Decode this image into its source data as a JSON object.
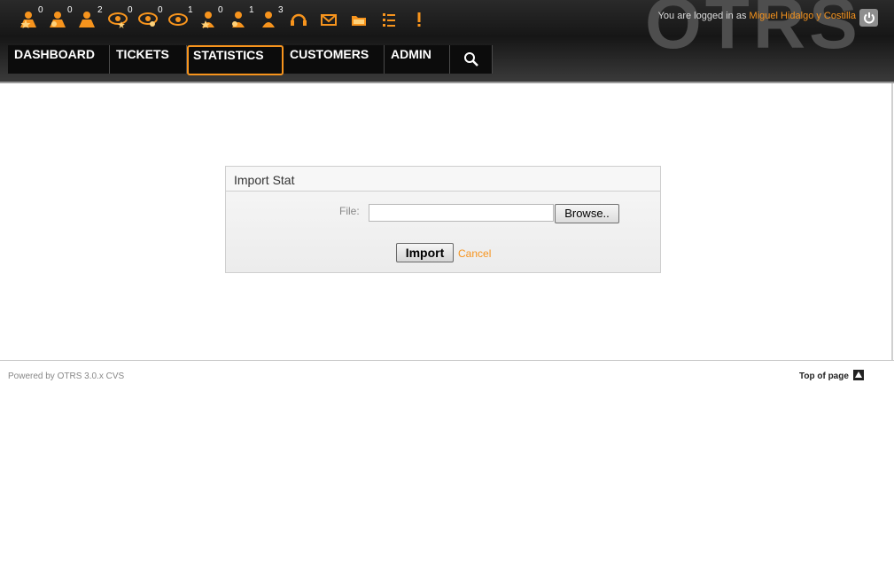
{
  "toolbar": {
    "icons": [
      {
        "name": "locked-new-tickets-icon",
        "count": "0"
      },
      {
        "name": "locked-reminder-tickets-icon",
        "count": "0"
      },
      {
        "name": "locked-tickets-icon",
        "count": "2"
      },
      {
        "name": "watched-new-tickets-icon",
        "count": "0"
      },
      {
        "name": "watched-reminder-tickets-icon",
        "count": "0"
      },
      {
        "name": "watched-tickets-icon",
        "count": "1"
      },
      {
        "name": "responsible-new-tickets-icon",
        "count": "0"
      },
      {
        "name": "responsible-reminder-tickets-icon",
        "count": "1"
      },
      {
        "name": "responsible-tickets-icon",
        "count": "3"
      },
      {
        "name": "new-phone-ticket-icon",
        "count": ""
      },
      {
        "name": "new-email-ticket-icon",
        "count": ""
      },
      {
        "name": "ticket-queue-icon",
        "count": ""
      },
      {
        "name": "ticket-status-view-icon",
        "count": ""
      },
      {
        "name": "ticket-escalation-icon",
        "count": ""
      }
    ]
  },
  "user": {
    "login_prefix": "You are logged in as",
    "name": "Miguel Hidalgo y Costilla"
  },
  "logo_text": "OTRS",
  "nav": {
    "items": [
      "DASHBOARD",
      "TICKETS",
      "STATISTICS",
      "CUSTOMERS",
      "ADMIN"
    ],
    "selected": "STATISTICS"
  },
  "import_panel": {
    "title": "Import Stat",
    "file_label": "File:",
    "browse_label": "Browse..",
    "import_label": "Import",
    "cancel_label": "Cancel"
  },
  "footer": {
    "powered_by": "Powered by OTRS 3.0.x CVS",
    "top_of_page": "Top of page"
  },
  "colors": {
    "accent": "#f7941d",
    "header_bg": "#1a1a1a",
    "nav_bg": "#0c0c0c"
  }
}
